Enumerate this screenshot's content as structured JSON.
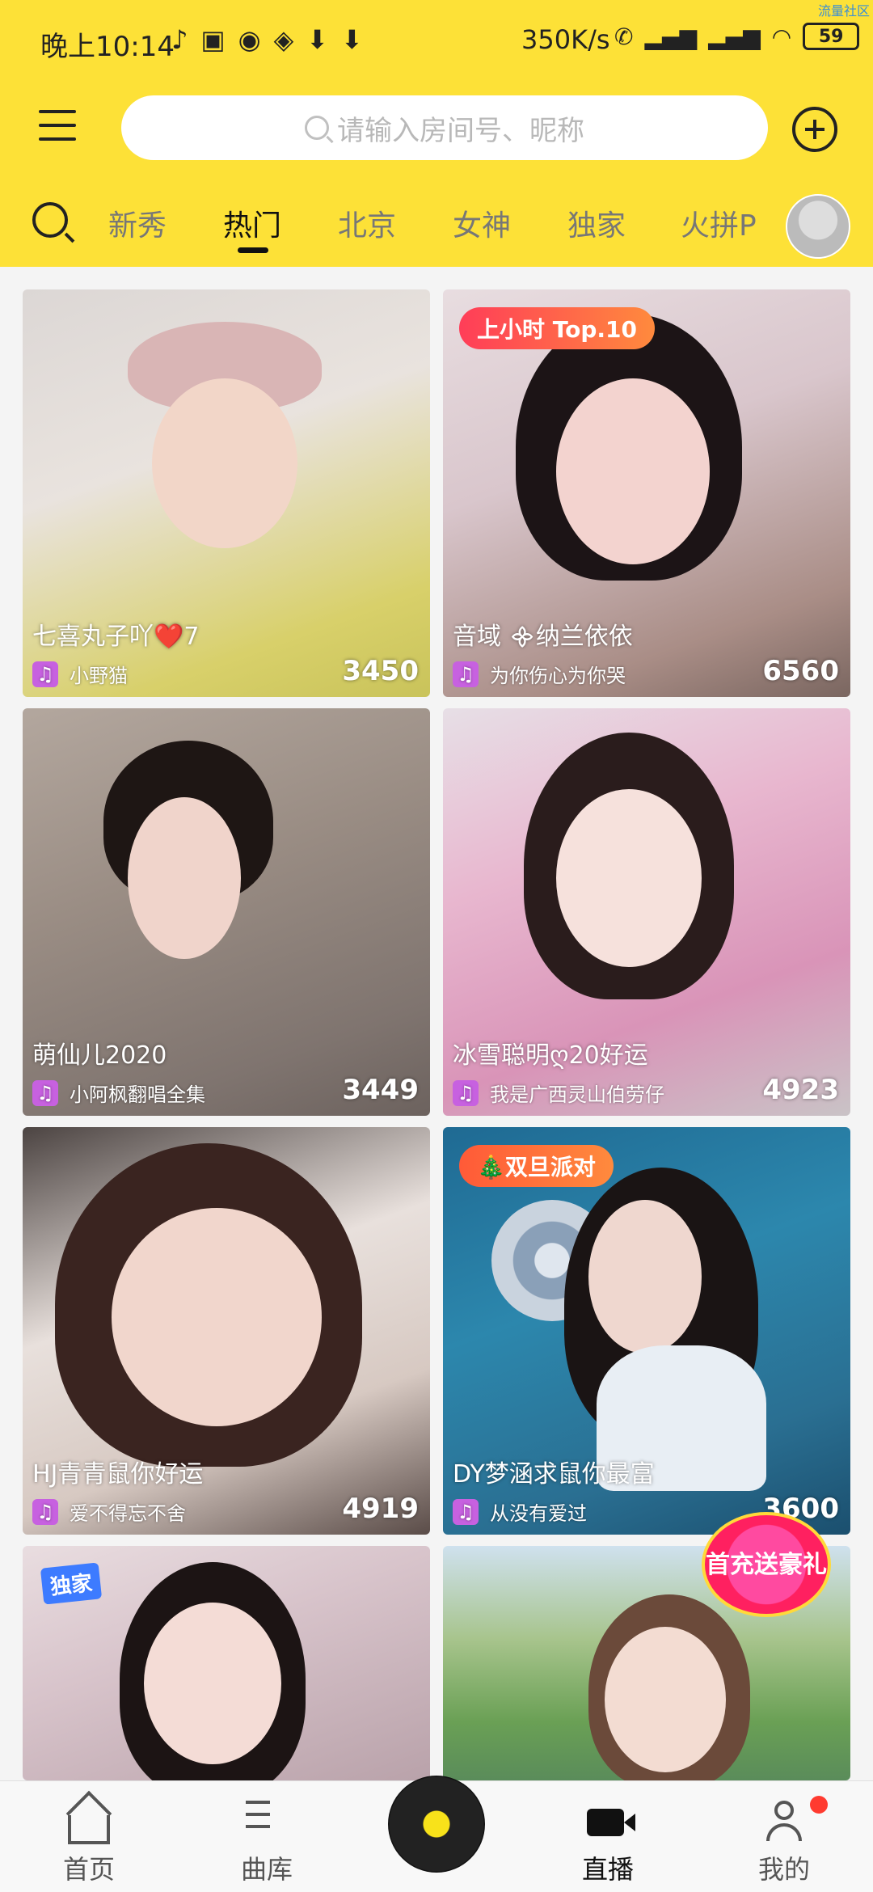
{
  "status": {
    "time": "晚上10:14",
    "speed": "350K/s",
    "battery": "59",
    "watermark": "流量社区"
  },
  "search": {
    "placeholder": "请输入房间号、昵称"
  },
  "tabs": [
    "新秀",
    "热门",
    "北京",
    "女神",
    "独家",
    "火拼P"
  ],
  "active_tab": "热门",
  "cards": [
    {
      "title": "七喜丸子吖❤️7",
      "song": "小野猫",
      "count": "3450",
      "badge": ""
    },
    {
      "title": "音域 ᯽纳兰依依",
      "song": "为你伤心为你哭",
      "count": "6560",
      "badge": "上小时 Top.10"
    },
    {
      "title": "萌仙儿2020",
      "song": "小阿枫翻唱全集",
      "count": "3449",
      "badge": ""
    },
    {
      "title": "冰雪聪明ღ20好运",
      "song": "我是广西灵山伯劳仔",
      "count": "4923",
      "badge": ""
    },
    {
      "title": "HJ青青鼠你好运",
      "song": "爱不得忘不舍",
      "count": "4919",
      "badge": ""
    },
    {
      "title": "DY梦涵求鼠你最富",
      "song": "从没有爱过",
      "count": "3600",
      "badge": "🎄双旦派对"
    }
  ],
  "extra": {
    "exclusive_tag": "独家",
    "promo": "首充送豪礼"
  },
  "nav": {
    "home": "首页",
    "library": "曲库",
    "live": "直播",
    "me": "我的"
  },
  "colors": {
    "header": "#fde137",
    "accent_purple": "#c761e0",
    "badge_red": "#ff5a4a",
    "badge_orange": "#ff8a3d"
  }
}
